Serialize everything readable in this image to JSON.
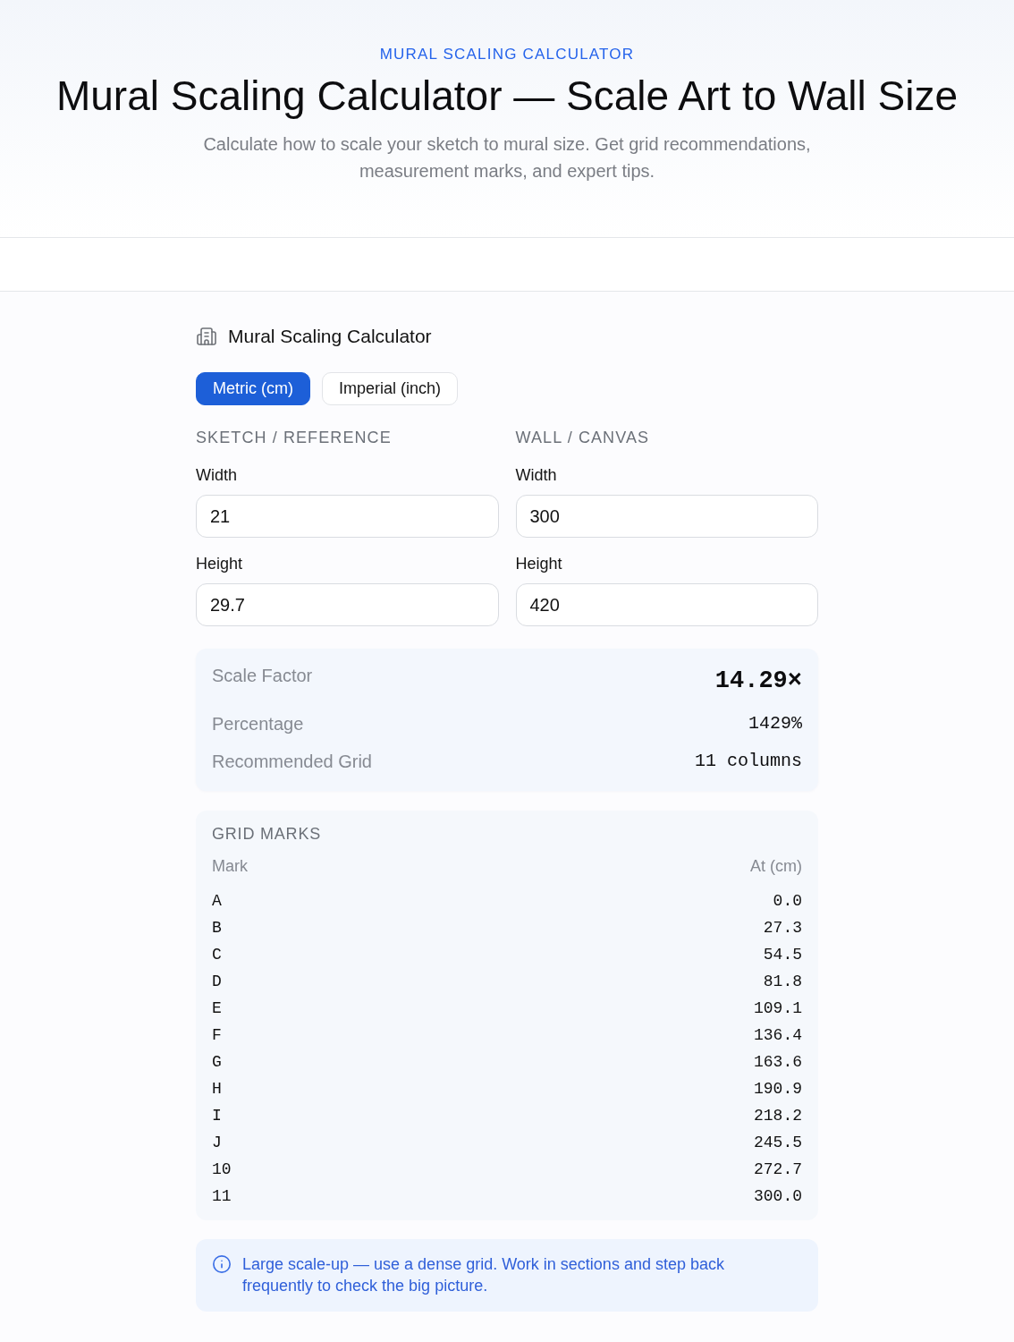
{
  "header": {
    "eyebrow": "MURAL SCALING CALCULATOR",
    "title": "Mural Scaling Calculator — Scale Art to Wall Size",
    "subtitle": "Calculate how to scale your sketch to mural size. Get grid recommendations, measurement marks, and expert tips."
  },
  "calculator": {
    "title": "Mural Scaling Calculator",
    "unit_tabs": [
      {
        "label": "Metric (cm)",
        "selected": true
      },
      {
        "label": "Imperial (inch)",
        "selected": false
      }
    ],
    "groups": [
      {
        "heading": "SKETCH / REFERENCE",
        "fields": [
          {
            "label": "Width",
            "value": "21"
          },
          {
            "label": "Height",
            "value": "29.7"
          }
        ]
      },
      {
        "heading": "WALL / CANVAS",
        "fields": [
          {
            "label": "Width",
            "value": "300"
          },
          {
            "label": "Height",
            "value": "420"
          }
        ]
      }
    ],
    "results": [
      {
        "kind": "primary",
        "label": "Scale Factor",
        "value": "14.29×"
      },
      {
        "kind": "plain",
        "label": "Percentage",
        "value": "1429%"
      },
      {
        "kind": "plain",
        "label": "Recommended Grid",
        "value": "11 columns"
      }
    ],
    "grid_marks": {
      "title": "GRID MARKS",
      "columns": [
        "Mark",
        "At (cm)"
      ],
      "rows": [
        {
          "mark": "A",
          "at": "0.0"
        },
        {
          "mark": "B",
          "at": "27.3"
        },
        {
          "mark": "C",
          "at": "54.5"
        },
        {
          "mark": "D",
          "at": "81.8"
        },
        {
          "mark": "E",
          "at": "109.1"
        },
        {
          "mark": "F",
          "at": "136.4"
        },
        {
          "mark": "G",
          "at": "163.6"
        },
        {
          "mark": "H",
          "at": "190.9"
        },
        {
          "mark": "I",
          "at": "218.2"
        },
        {
          "mark": "J",
          "at": "245.5"
        },
        {
          "mark": "10",
          "at": "272.7"
        },
        {
          "mark": "11",
          "at": "300.0"
        }
      ]
    },
    "tip": {
      "text": "Large scale-up — use a dense grid. Work in sections and step back frequently to check the big picture."
    }
  }
}
